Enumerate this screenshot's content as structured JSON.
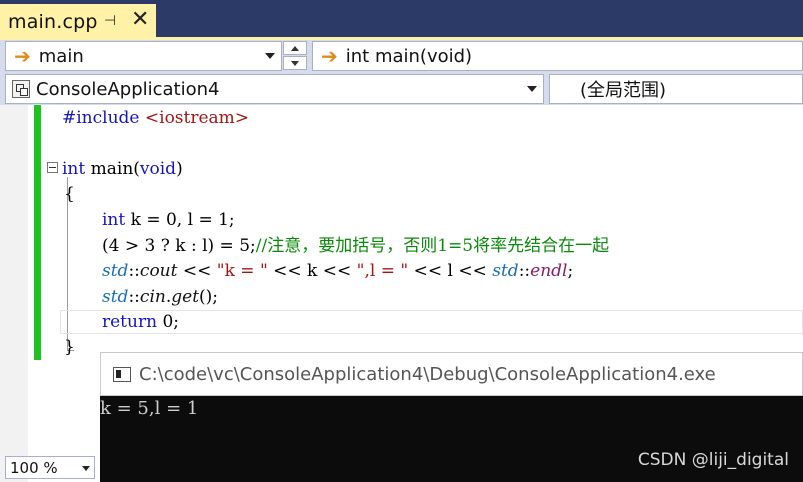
{
  "tab": {
    "title": "main.cpp",
    "pin_icon": "pin-icon",
    "close_icon": "close-icon"
  },
  "nav1": {
    "scope_value": "main",
    "function_value": "int main(void)",
    "arrow_icon": "arrow-right-icon"
  },
  "nav2": {
    "project_value": "ConsoleApplication4",
    "scope_value": "(全局范围)"
  },
  "code": {
    "line1": {
      "directive": "#include",
      "header": "<iostream>"
    },
    "line2": {
      "kw": "int",
      "rest": " main(",
      "kw2": "void",
      "close": ")"
    },
    "line3": "{",
    "line4": {
      "kw": "int",
      "rest": " k = 0, l = 1;"
    },
    "line5": {
      "code": "(4 > 3 ? k : l) = 5;",
      "comment": "//注意，要加括号，否则1=5将率先结合在一起"
    },
    "line6": {
      "ns": "std",
      "sep1": "::",
      "obj": "cout",
      "op1": " << ",
      "s1": "\"k = \"",
      "op2": " << k << ",
      "s2": "\",l = \"",
      "op3": " << l << ",
      "ns2": "std",
      "sep2": "::",
      "endl": "endl",
      "end": ";"
    },
    "line7": {
      "ns": "std",
      "sep": "::",
      "obj": "cin",
      "dot": ".",
      "fn": "get",
      "end": "();"
    },
    "line8": {
      "kw": "return",
      "rest": " 0;"
    },
    "line9": "}"
  },
  "zoom": {
    "value": "100 %"
  },
  "console": {
    "title": "C:\\code\\vc\\ConsoleApplication4\\Debug\\ConsoleApplication4.exe",
    "output": "k = 5,l = 1",
    "watermark": "CSDN @liji_digital"
  },
  "colors": {
    "tab_active": "#fff1a5",
    "tab_strip": "#2b3a66",
    "change_bar": "#1fc31f",
    "keyword": "#1515c0"
  }
}
